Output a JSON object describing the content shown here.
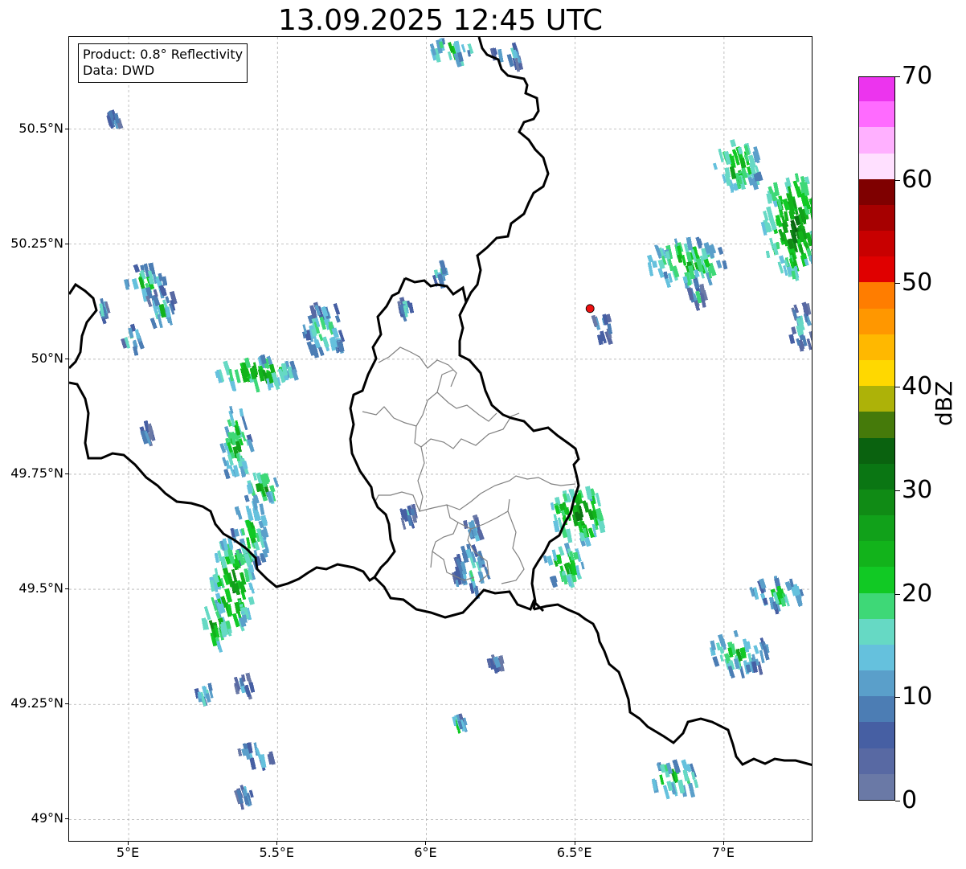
{
  "title": "13.09.2025 12:45 UTC",
  "info_box": {
    "product": "Product: 0.8° Reflectivity",
    "source": "Data: DWD"
  },
  "map_extent": {
    "lon": [
      4.8,
      7.3
    ],
    "lat": [
      48.95,
      50.7
    ]
  },
  "lat_ticks": [
    {
      "value": 50.5,
      "label": "50.5°N"
    },
    {
      "value": 50.25,
      "label": "50.25°N"
    },
    {
      "value": 50.0,
      "label": "50°N"
    },
    {
      "value": 49.75,
      "label": "49.75°N"
    },
    {
      "value": 49.5,
      "label": "49.5°N"
    },
    {
      "value": 49.25,
      "label": "49.25°N"
    },
    {
      "value": 49.0,
      "label": "49°N"
    }
  ],
  "lon_ticks": [
    {
      "value": 5.0,
      "label": "5°E"
    },
    {
      "value": 5.5,
      "label": "5.5°E"
    },
    {
      "value": 6.0,
      "label": "6°E"
    },
    {
      "value": 6.5,
      "label": "6.5°E"
    },
    {
      "value": 7.0,
      "label": "7°E"
    }
  ],
  "radar_site": {
    "lon": 6.55,
    "lat": 50.11,
    "color": "#ee1111"
  },
  "colorbar": {
    "label": "dBZ",
    "range": [
      0,
      70
    ],
    "ticks": [
      "0",
      "10",
      "20",
      "30",
      "40",
      "50",
      "60",
      "70"
    ],
    "colors": [
      "#6a79a6",
      "#5869a3",
      "#465fa3",
      "#4c7db4",
      "#5a9fca",
      "#65c1dd",
      "#66d9c4",
      "#3ed877",
      "#11c924",
      "#12b31b",
      "#11a11a",
      "#108b15",
      "#0a7613",
      "#0a620f",
      "#457a0a",
      "#adb208",
      "#ffd800",
      "#ffb800",
      "#ff9700",
      "#ff7d00",
      "#e00000",
      "#c80000",
      "#a60000",
      "#7f0000",
      "#ffe0ff",
      "#ffb0ff",
      "#ff6bff",
      "#ec34ee"
    ]
  },
  "precip_cells": [
    {
      "lon": 4.94,
      "lat": 50.53,
      "rx": 0.02,
      "ry": 0.02,
      "dbz": 14
    },
    {
      "lon": 5.05,
      "lat": 50.18,
      "rx": 0.07,
      "ry": 0.03,
      "dbz": 20
    },
    {
      "lon": 5.1,
      "lat": 50.12,
      "rx": 0.05,
      "ry": 0.04,
      "dbz": 17
    },
    {
      "lon": 5.0,
      "lat": 50.05,
      "rx": 0.03,
      "ry": 0.03,
      "dbz": 19
    },
    {
      "lon": 4.9,
      "lat": 50.12,
      "rx": 0.02,
      "ry": 0.02,
      "dbz": 15
    },
    {
      "lon": 5.65,
      "lat": 50.07,
      "rx": 0.07,
      "ry": 0.06,
      "dbz": 18
    },
    {
      "lon": 5.42,
      "lat": 49.98,
      "rx": 0.14,
      "ry": 0.03,
      "dbz": 24
    },
    {
      "lon": 5.35,
      "lat": 49.82,
      "rx": 0.05,
      "ry": 0.08,
      "dbz": 22
    },
    {
      "lon": 5.44,
      "lat": 49.73,
      "rx": 0.05,
      "ry": 0.03,
      "dbz": 24
    },
    {
      "lon": 5.4,
      "lat": 49.63,
      "rx": 0.06,
      "ry": 0.08,
      "dbz": 20
    },
    {
      "lon": 5.34,
      "lat": 49.52,
      "rx": 0.07,
      "ry": 0.1,
      "dbz": 26
    },
    {
      "lon": 5.28,
      "lat": 49.43,
      "rx": 0.04,
      "ry": 0.05,
      "dbz": 25
    },
    {
      "lon": 5.25,
      "lat": 49.28,
      "rx": 0.03,
      "ry": 0.02,
      "dbz": 18
    },
    {
      "lon": 5.38,
      "lat": 49.3,
      "rx": 0.03,
      "ry": 0.02,
      "dbz": 12
    },
    {
      "lon": 5.42,
      "lat": 49.15,
      "rx": 0.06,
      "ry": 0.02,
      "dbz": 16
    },
    {
      "lon": 5.38,
      "lat": 49.06,
      "rx": 0.03,
      "ry": 0.02,
      "dbz": 14
    },
    {
      "lon": 5.05,
      "lat": 49.85,
      "rx": 0.02,
      "ry": 0.02,
      "dbz": 12
    },
    {
      "lon": 6.07,
      "lat": 50.68,
      "rx": 0.08,
      "ry": 0.02,
      "dbz": 22
    },
    {
      "lon": 6.27,
      "lat": 50.67,
      "rx": 0.06,
      "ry": 0.02,
      "dbz": 14
    },
    {
      "lon": 6.03,
      "lat": 50.2,
      "rx": 0.03,
      "ry": 0.02,
      "dbz": 20
    },
    {
      "lon": 5.92,
      "lat": 50.12,
      "rx": 0.02,
      "ry": 0.02,
      "dbz": 14
    },
    {
      "lon": 6.5,
      "lat": 49.67,
      "rx": 0.09,
      "ry": 0.06,
      "dbz": 26
    },
    {
      "lon": 6.45,
      "lat": 49.56,
      "rx": 0.07,
      "ry": 0.04,
      "dbz": 24
    },
    {
      "lon": 6.14,
      "lat": 49.55,
      "rx": 0.06,
      "ry": 0.05,
      "dbz": 18
    },
    {
      "lon": 6.15,
      "lat": 49.64,
      "rx": 0.03,
      "ry": 0.02,
      "dbz": 15
    },
    {
      "lon": 5.93,
      "lat": 49.67,
      "rx": 0.03,
      "ry": 0.02,
      "dbz": 13
    },
    {
      "lon": 6.22,
      "lat": 49.35,
      "rx": 0.03,
      "ry": 0.01,
      "dbz": 10
    },
    {
      "lon": 6.1,
      "lat": 49.22,
      "rx": 0.03,
      "ry": 0.01,
      "dbz": 18
    },
    {
      "lon": 6.58,
      "lat": 50.08,
      "rx": 0.03,
      "ry": 0.03,
      "dbz": 15
    },
    {
      "lon": 6.87,
      "lat": 50.22,
      "rx": 0.13,
      "ry": 0.05,
      "dbz": 22
    },
    {
      "lon": 7.04,
      "lat": 50.43,
      "rx": 0.08,
      "ry": 0.05,
      "dbz": 24
    },
    {
      "lon": 7.22,
      "lat": 50.3,
      "rx": 0.1,
      "ry": 0.11,
      "dbz": 27
    },
    {
      "lon": 7.25,
      "lat": 50.08,
      "rx": 0.04,
      "ry": 0.05,
      "dbz": 14
    },
    {
      "lon": 7.17,
      "lat": 49.5,
      "rx": 0.09,
      "ry": 0.03,
      "dbz": 20
    },
    {
      "lon": 7.04,
      "lat": 49.37,
      "rx": 0.1,
      "ry": 0.04,
      "dbz": 20
    },
    {
      "lon": 6.83,
      "lat": 49.1,
      "rx": 0.09,
      "ry": 0.03,
      "dbz": 23
    },
    {
      "lon": 6.9,
      "lat": 50.15,
      "rx": 0.03,
      "ry": 0.02,
      "dbz": 14
    }
  ]
}
